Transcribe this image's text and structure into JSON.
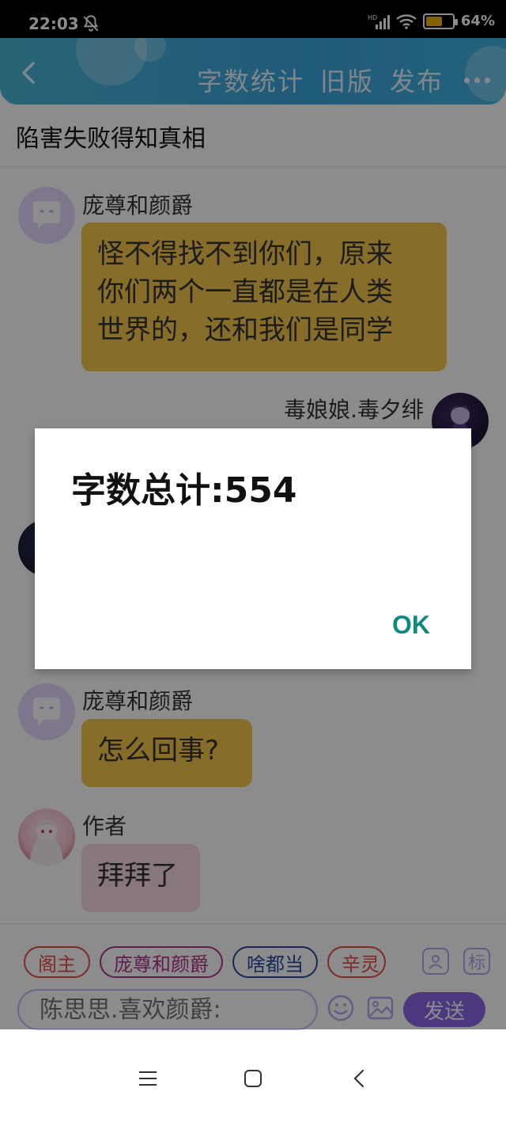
{
  "status_bar": {
    "time": "22:03",
    "battery_pct": "64%",
    "battery_level": 0.64,
    "network": "HD"
  },
  "header": {
    "actions": [
      "字数统计",
      "旧版",
      "发布"
    ]
  },
  "story": {
    "title": "陷害失败得知真相"
  },
  "messages": [
    {
      "side": "left",
      "name": "庞尊和颜爵",
      "text": [
        "怪不得找不到你们，原来",
        "你们两个一直都是在人类",
        "世界的，还和我们是同学"
      ]
    },
    {
      "side": "right",
      "name": "毒娘娘.毒夕绯"
    },
    {
      "side": "left",
      "name": "庞尊和颜爵",
      "text": [
        "怎么回事?"
      ]
    },
    {
      "side": "left",
      "name": "作者",
      "text": [
        "拜拜了"
      ]
    }
  ],
  "input": {
    "chips": [
      "阁主",
      "庞尊和颜爵",
      "啥都当",
      "辛灵"
    ],
    "side_label": "标",
    "placeholder": "陈思思.喜欢颜爵:",
    "send_label": "发送"
  },
  "dialog": {
    "message": "字数总计:554",
    "ok_label": "OK"
  },
  "colors": {
    "accent": "#8a66e6",
    "ok": "#0f8a7e",
    "bubble": "#f6c64e",
    "header": "#3aa7de"
  }
}
